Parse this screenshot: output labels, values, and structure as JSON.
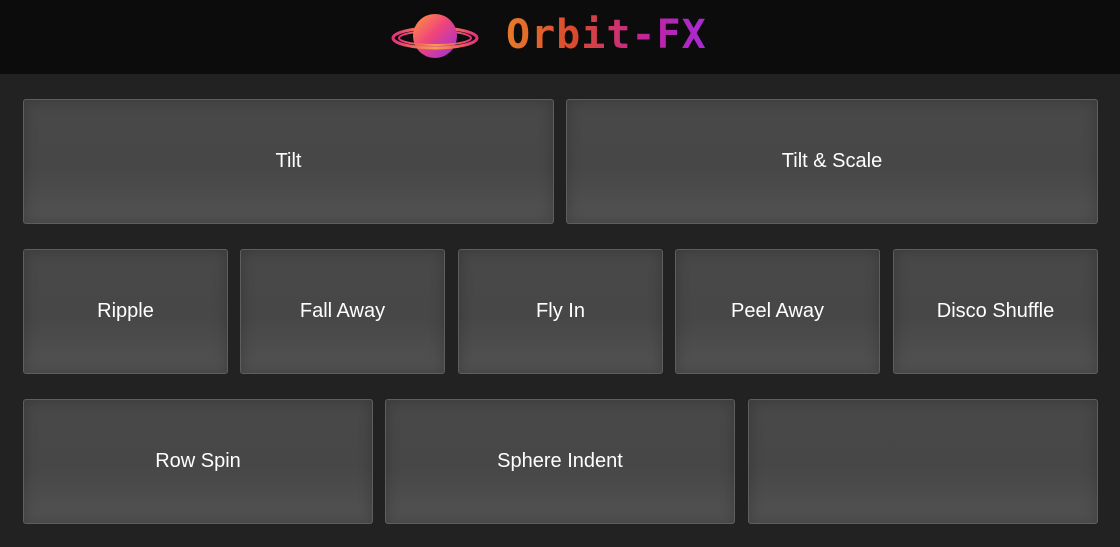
{
  "header": {
    "logo_text": "Orbit-FX",
    "logo_icon": "planet-icon",
    "gradient_colors": [
      "#e67a2a",
      "#d9482e",
      "#c0249d",
      "#a52bd6"
    ]
  },
  "colors": {
    "background": "#222222",
    "header_background": "#0c0c0c",
    "tile_background": "#484848",
    "tile_text": "#ffffff"
  },
  "effects": [
    {
      "label": "Tilt"
    },
    {
      "label": "Tilt & Scale"
    },
    {
      "label": "Ripple"
    },
    {
      "label": "Fall Away"
    },
    {
      "label": "Fly In"
    },
    {
      "label": "Peel Away"
    },
    {
      "label": "Disco Shuffle"
    },
    {
      "label": "Row Spin"
    },
    {
      "label": "Sphere Indent"
    },
    {
      "label": ""
    }
  ]
}
